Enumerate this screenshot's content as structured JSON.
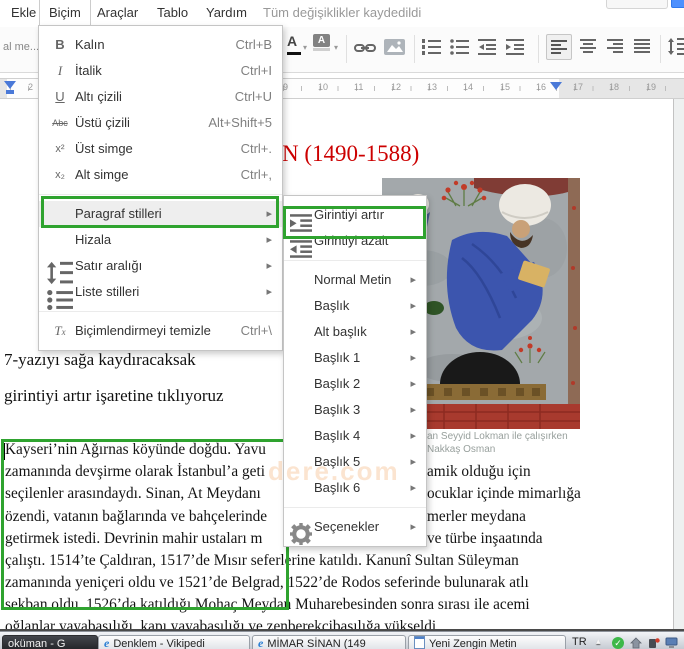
{
  "colors": {
    "annotation_green": "#2fa32f",
    "title_red": "#cc0000",
    "share_blue": "#4d90fe"
  },
  "menubar": {
    "items": [
      "Ekle",
      "Biçim",
      "Araçlar",
      "Tablo",
      "Yardım"
    ],
    "status": "Tüm değişiklikler kaydedildi"
  },
  "toolbar": {
    "style_selector_text": "al me..."
  },
  "ruler": {
    "left_number": "2",
    "numbers": [
      "9",
      "10",
      "11",
      "12",
      "13",
      "14",
      "15",
      "16",
      "17",
      "18",
      "19"
    ]
  },
  "format_menu": {
    "items": [
      {
        "label": "Kalın",
        "shortcut": "Ctrl+B"
      },
      {
        "label": "İtalik",
        "shortcut": "Ctrl+I"
      },
      {
        "label": "Altı çizili",
        "shortcut": "Ctrl+U"
      },
      {
        "label": "Üstü çizili",
        "shortcut": "Alt+Shift+5"
      },
      {
        "label": "Üst simge",
        "shortcut": "Ctrl+."
      },
      {
        "label": "Alt simge",
        "shortcut": "Ctrl+,"
      },
      {
        "label": "Paragraf stilleri",
        "shortcut": ""
      },
      {
        "label": "Hizala",
        "shortcut": ""
      },
      {
        "label": "Satır aralığı",
        "shortcut": ""
      },
      {
        "label": "Liste stilleri",
        "shortcut": ""
      },
      {
        "label": "Biçimlendirmeyi temizle",
        "shortcut": "Ctrl+\\"
      }
    ]
  },
  "submenu": {
    "items": [
      {
        "label": "Girintiyi artır"
      },
      {
        "label": "Girintiyi azalt"
      },
      {
        "label": "Normal Metin"
      },
      {
        "label": "Başlık"
      },
      {
        "label": "Alt başlık"
      },
      {
        "label": "Başlık 1"
      },
      {
        "label": "Başlık 2"
      },
      {
        "label": "Başlık 3"
      },
      {
        "label": "Başlık 4"
      },
      {
        "label": "Başlık 5"
      },
      {
        "label": "Başlık 6"
      },
      {
        "label": "Seçenekler"
      }
    ]
  },
  "document": {
    "title_visible": "N (1490-1588)",
    "instruction1": "7-yazıyı sağa kaydıracaksak",
    "instruction2": "girintiyi artır işaretine tıklıyoruz",
    "caption_line1": "an Seyyid Lokman ile çalışırken",
    "caption_line2": "Nakkaş Osman",
    "watermark_fragment": "dere.com",
    "lines": [
      {
        "left": "Kayseri’nin Ağırnas köyünde doğdu. Yavu",
        "right": ""
      },
      {
        "left": "zamanında devşirme olarak İstanbul’a geti",
        "right": "amik olduğu için"
      },
      {
        "left": "seçilenler arasındaydı. Sinan, At Meydanı",
        "right": "ocuklar içinde mimarlığa"
      },
      {
        "left": "özendi, vatanın bağlarında ve bahçelerinde",
        "right": "merler meydana"
      },
      {
        "left": "getirmek istedi. Devrinin mahir ustaları m",
        "right": "ve türbe inşaatında"
      },
      {
        "left": "çalıştı. 1514’te Çaldıran, 1517’de Mısır seferlerine katıldı. Kanunî Sultan Süleyman",
        "right": ""
      },
      {
        "left": "zamanında yeniçeri oldu ve 1521’de Belgrad, 1522’de Rodos seferinde bulunarak atlı",
        "right": ""
      },
      {
        "left": "sekban oldu. 1526’da katıldığı Mohaç Meydan Muharebesinden sonra sırası ile acemi",
        "right": ""
      },
      {
        "left": "oğlanlar yayabaşılığı, kapı yayabaşılığı ve zenberekçibaşılığa yükseldi.",
        "right": ""
      }
    ]
  },
  "taskbar": {
    "buttons": [
      {
        "label": "oküman - G"
      },
      {
        "label": "Denklem - Vikipedi"
      },
      {
        "label": "MİMAR SİNAN (149"
      },
      {
        "label": "Yeni Zengin Metin"
      }
    ],
    "tray": {
      "language": "TR"
    }
  }
}
